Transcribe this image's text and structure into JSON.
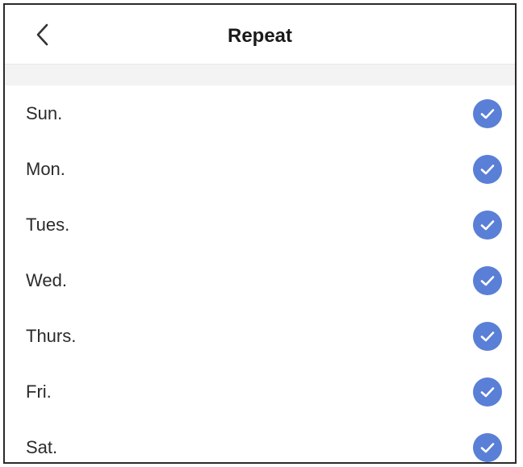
{
  "header": {
    "title": "Repeat",
    "back_icon": "chevron-left-icon"
  },
  "days": [
    {
      "label": "Sun.",
      "checked": true
    },
    {
      "label": "Mon.",
      "checked": true
    },
    {
      "label": "Tues.",
      "checked": true
    },
    {
      "label": "Wed.",
      "checked": true
    },
    {
      "label": "Thurs.",
      "checked": true
    },
    {
      "label": "Fri.",
      "checked": true
    },
    {
      "label": "Sat.",
      "checked": true
    }
  ],
  "colors": {
    "check_fill": "#5a7fd6",
    "check_mark": "#ffffff"
  }
}
